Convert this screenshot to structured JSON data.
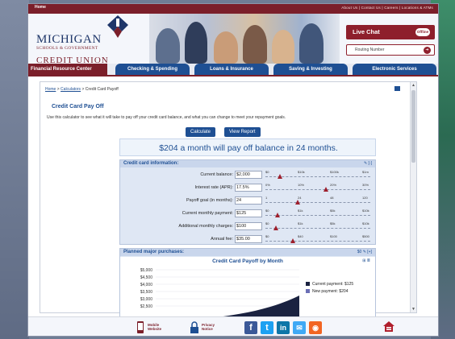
{
  "topbar": {
    "home_tab": "Home",
    "links": "About Us  |  Contact Us  |  Careers  |  Locations & ATMs"
  },
  "logo": {
    "line1": "MICHIGAN",
    "line2a": "SCHOOLS & GOVERNMENT",
    "line3": "CREDIT UNION"
  },
  "livechat": {
    "label": "Live Chat",
    "status": "Offline"
  },
  "routing": {
    "label": "Routing Number"
  },
  "nav": {
    "financial_resource_center": "Financial Resource Center",
    "tabs": [
      "Checking & Spending",
      "Loans & Insurance",
      "Saving & Investing",
      "Electronic Services"
    ]
  },
  "breadcrumb": {
    "home": "Home",
    "calculators": "Calculators",
    "current": "Credit Card Payoff",
    "sep": " > "
  },
  "page": {
    "title": "Credit Card Pay Off",
    "intro": "Use this calculator to see what it will take to pay off your credit card balance, and what you can change to meet your repayment goals."
  },
  "buttons": {
    "calculate": "Calculate",
    "view_report": "View Report"
  },
  "result": "$204 a month will pay off balance in 24 months.",
  "credit_card_panel": {
    "title": "Credit card information:",
    "tools": "✎ [-]",
    "rows": [
      {
        "label": "Current balance:",
        "value": "$2,000",
        "ticks": [
          "$0",
          "$10k",
          "$100k",
          "$1m"
        ],
        "level": 0.12
      },
      {
        "label": "Interest rate (APR):",
        "value": "17.5%",
        "ticks": [
          "0%",
          "10%",
          "20%",
          "30%"
        ],
        "level": 0.58
      },
      {
        "label": "Payoff goal (in months):",
        "value": "24",
        "ticks": [
          "1",
          "24",
          "48",
          "120"
        ],
        "level": 0.3
      },
      {
        "label": "Current monthly payment:",
        "value": "$125",
        "ticks": [
          "$0",
          "$1k",
          "$5k",
          "$10k"
        ],
        "level": 0.1
      },
      {
        "label": "Additional monthly charges:",
        "value": "$100",
        "ticks": [
          "$0",
          "$1k",
          "$5k",
          "$10k"
        ],
        "level": 0.08
      },
      {
        "label": "Annual fee:",
        "value": "$35.00",
        "ticks": [
          "$0",
          "$40",
          "$100",
          "$500"
        ],
        "level": 0.25
      }
    ]
  },
  "planned_panel": {
    "title": "Planned major purchases:",
    "value": "$0",
    "tools": "✎ [+]"
  },
  "chart": {
    "title": "Credit Card Payoff by Month",
    "icons": "⊞ ≣"
  },
  "chart_data": {
    "type": "area",
    "title": "Credit Card Payoff by Month",
    "y_tick_labels": [
      "$5,000",
      "$4,500",
      "$4,000",
      "$3,500",
      "$3,000",
      "$2,500"
    ],
    "series": [
      {
        "name": "Current payment: $125",
        "color": "#1a2240"
      },
      {
        "name": "New payment: $204",
        "color": "#6b6fb5"
      }
    ]
  },
  "footer": {
    "mobile": "Mobile\nWebsite",
    "privacy": "Privacy\nNotice"
  },
  "colors": {
    "brand_red": "#7b1f2a",
    "brand_blue": "#1e4f93"
  }
}
